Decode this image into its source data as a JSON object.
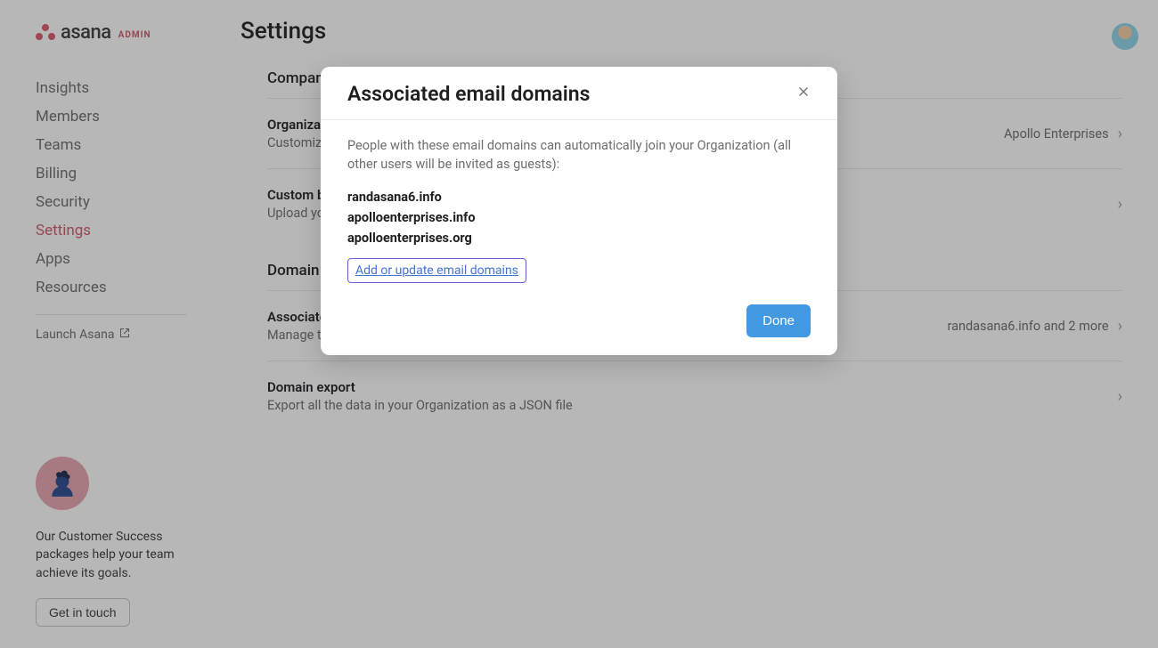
{
  "brand": {
    "name": "asana",
    "suffix": "ADMIN"
  },
  "sidebar": {
    "items": [
      {
        "label": "Insights",
        "active": false
      },
      {
        "label": "Members",
        "active": false
      },
      {
        "label": "Teams",
        "active": false
      },
      {
        "label": "Billing",
        "active": false
      },
      {
        "label": "Security",
        "active": false
      },
      {
        "label": "Settings",
        "active": true
      },
      {
        "label": "Apps",
        "active": false
      },
      {
        "label": "Resources",
        "active": false
      }
    ],
    "launch_label": "Launch Asana"
  },
  "cs": {
    "text": "Our Customer Success packages help your team achieve its goals.",
    "button": "Get in touch"
  },
  "page": {
    "title": "Settings",
    "sections": [
      {
        "heading": "Company",
        "rows": [
          {
            "title": "Organization name",
            "sub": "Customize your Organization's name",
            "value": "Apollo Enterprises"
          },
          {
            "title": "Custom branding",
            "sub": "Upload your Organization's logo to customize Asana email notifications and forms",
            "value": ""
          }
        ]
      },
      {
        "heading": "Domain management",
        "rows": [
          {
            "title": "Associated email domains",
            "sub": "Manage the email domains that are allowed to join your Organization",
            "value": "randasana6.info and 2 more"
          },
          {
            "title": "Domain export",
            "sub": "Export all the data in your Organization as a JSON file",
            "value": ""
          }
        ]
      }
    ]
  },
  "modal": {
    "title": "Associated email domains",
    "description": "People with these email domains can automatically join your Organization (all other users will be invited as guests):",
    "domains": [
      "randasana6.info",
      "apolloenterprises.info",
      "apolloenterprises.org"
    ],
    "add_link": "Add or update email domains",
    "done": "Done"
  }
}
